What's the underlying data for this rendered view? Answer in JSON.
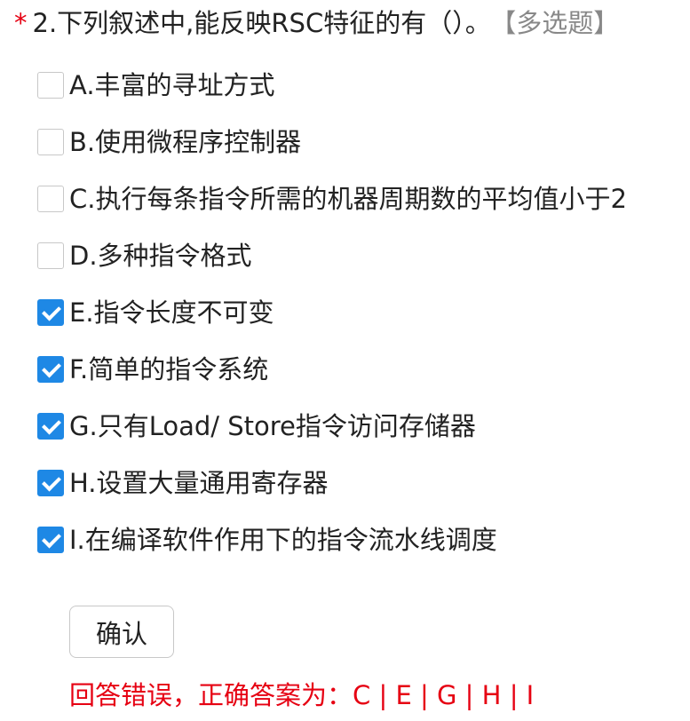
{
  "question": {
    "required_mark": "*",
    "text": "2.下列叙述中,能反映RSC特征的有（）。",
    "type_label": "【多选题】"
  },
  "options": [
    {
      "label": "A.丰富的寻址方式",
      "checked": false
    },
    {
      "label": "B.使用微程序控制器",
      "checked": false
    },
    {
      "label": "C.执行每条指令所需的机器周期数的平均值小于2",
      "checked": false
    },
    {
      "label": "D.多种指令格式",
      "checked": false
    },
    {
      "label": "E.指令长度不可变",
      "checked": true
    },
    {
      "label": "F.简单的指令系统",
      "checked": true
    },
    {
      "label": "G.只有Load/ Store指令访问存储器",
      "checked": true
    },
    {
      "label": "H.设置大量通用寄存器",
      "checked": true
    },
    {
      "label": "I.在编译软件作用下的指令流水线调度",
      "checked": true
    }
  ],
  "confirm_label": "确认",
  "result_text": "回答错误，正确答案为：C | E | G | H | I",
  "colors": {
    "accent": "#1e88e5",
    "error": "#e60012"
  }
}
